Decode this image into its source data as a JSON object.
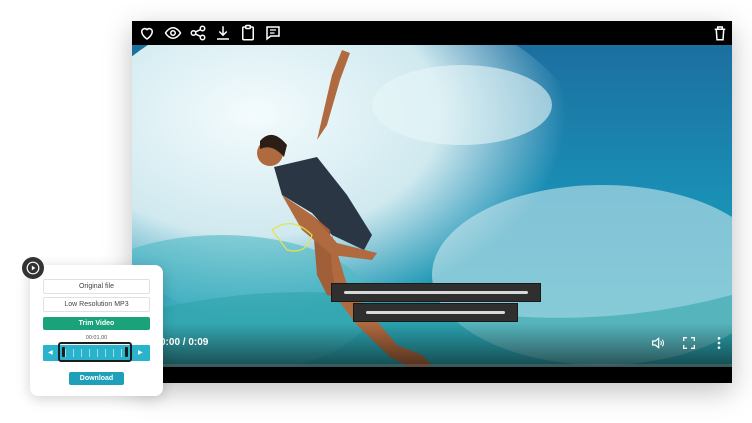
{
  "player": {
    "toolbar_icons": [
      "heart-icon",
      "eye-icon",
      "share-icon",
      "download-icon",
      "clipboard-icon",
      "comment-icon",
      "trash-icon"
    ],
    "time_display": "0:00 / 0:09",
    "progress": 0.0,
    "control_icons": [
      "volume-icon",
      "fullscreen-icon",
      "more-vertical-icon"
    ]
  },
  "panel": {
    "original_file": "Original file",
    "low_res": "Low Resolution MP3",
    "trim_video": "Trim Video",
    "trim_time": "00:01.00",
    "download": "Download"
  },
  "colors": {
    "trim_green": "#1aa37a",
    "track_blue": "#29b3cc",
    "download_blue": "#1f9fb8"
  }
}
